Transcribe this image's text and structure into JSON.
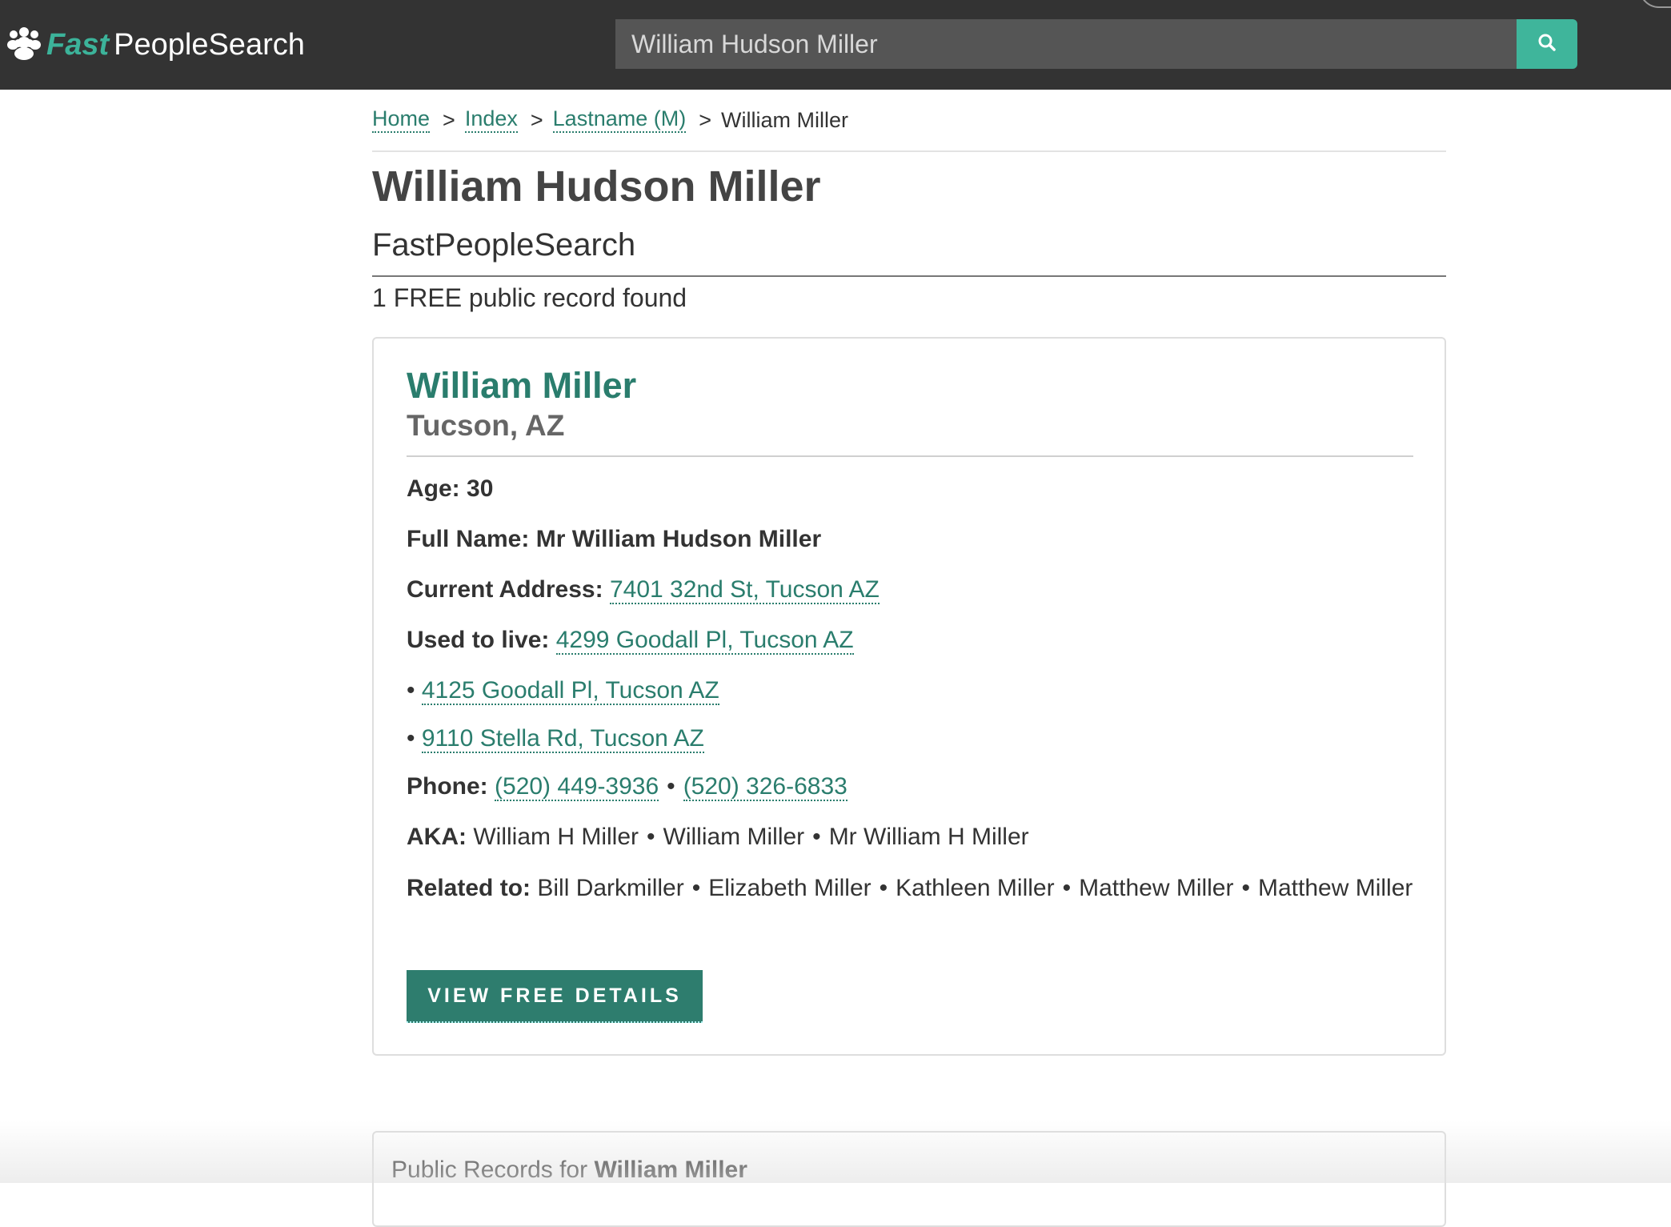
{
  "header": {
    "logo_fast": "Fast",
    "logo_people": "PeopleSearch",
    "search_value": "William Hudson Miller"
  },
  "breadcrumb": {
    "home": "Home",
    "index": "Index",
    "lastname": "Lastname (M)",
    "current": "William Miller",
    "sep": ">"
  },
  "page": {
    "title": "William Hudson Miller",
    "subtitle": "FastPeopleSearch",
    "record_count": "1 FREE public record found"
  },
  "record": {
    "name": "William Miller",
    "location": "Tucson, AZ",
    "age_label": "Age:",
    "age_value": "30",
    "fullname_label": "Full Name:",
    "fullname_value": "Mr William Hudson Miller",
    "current_address_label": "Current Address:",
    "current_address": "7401 32nd St, Tucson AZ",
    "used_to_live_label": "Used to live:",
    "past_addresses": [
      "4299 Goodall Pl, Tucson AZ",
      "4125 Goodall Pl, Tucson AZ",
      "9110 Stella Rd, Tucson AZ"
    ],
    "phone_label": "Phone:",
    "phones": [
      "(520) 449-3936",
      "(520) 326-6833"
    ],
    "aka_label": "AKA:",
    "aka": [
      "William H Miller",
      "William Miller",
      "Mr William H Miller"
    ],
    "related_label": "Related to:",
    "related": [
      "Bill Darkmiller",
      "Elizabeth Miller",
      "Kathleen Miller",
      "Matthew Miller",
      "Matthew Miller"
    ],
    "button_label": "VIEW FREE DETAILS"
  },
  "public_records": {
    "prefix": "Public Records for",
    "name": "William Miller"
  },
  "colors": {
    "accent": "#2a7d6d",
    "brand_green": "#3cb39a",
    "header_bg": "#333333"
  },
  "icons": {
    "logo": "people-group-icon",
    "search": "search-icon"
  }
}
